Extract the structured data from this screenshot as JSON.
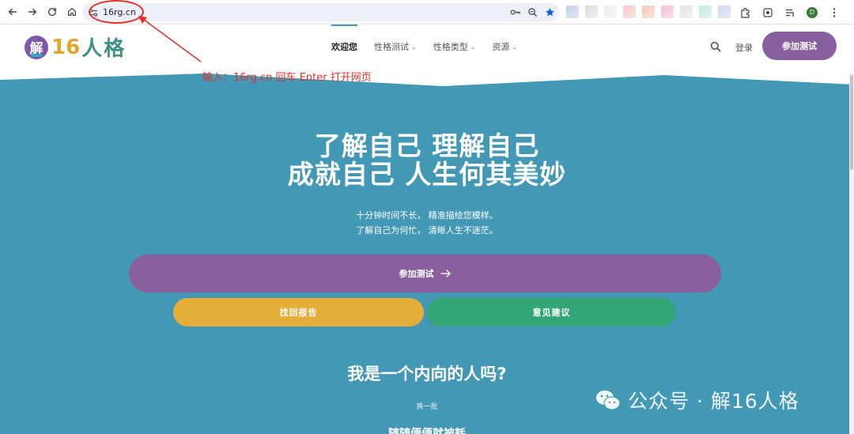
{
  "browser": {
    "url": "16rg.cn"
  },
  "site": {
    "logo_char": "解",
    "logo_num": "16",
    "logo_text": "人格",
    "nav": [
      {
        "label": "欢迎您",
        "has_menu": false,
        "active": true
      },
      {
        "label": "性格测试",
        "has_menu": true
      },
      {
        "label": "性格类型",
        "has_menu": true
      },
      {
        "label": "资源",
        "has_menu": true
      }
    ],
    "login_label": "登录",
    "join_label": "参加测试"
  },
  "annotation": {
    "text": "输入：16rg.cn    回车 Enter 打开网页",
    "color": "#e0312b"
  },
  "hero": {
    "headline_1": "了解自己 理解自己",
    "headline_2": "成就自己 人生何其美妙",
    "subtitle_1": "十分钟时间不长， 精准描绘您模样。",
    "subtitle_2": "了解自己为何忙， 清晰人生不迷茫。",
    "join_button": "参加测试",
    "recover_button": "找回报告",
    "feedback_button": "意见建议",
    "question_title": "我是一个内向的人吗?",
    "refresh_label": "换一批",
    "next_question": "随随便便就被耗"
  },
  "watermark": {
    "text": "公众号 · 解16人格"
  },
  "colors": {
    "hero_bg": "#4298b5",
    "purple": "#88609d",
    "yellow": "#e4ae39",
    "green": "#33a474",
    "annotation_red": "#e0312b"
  }
}
